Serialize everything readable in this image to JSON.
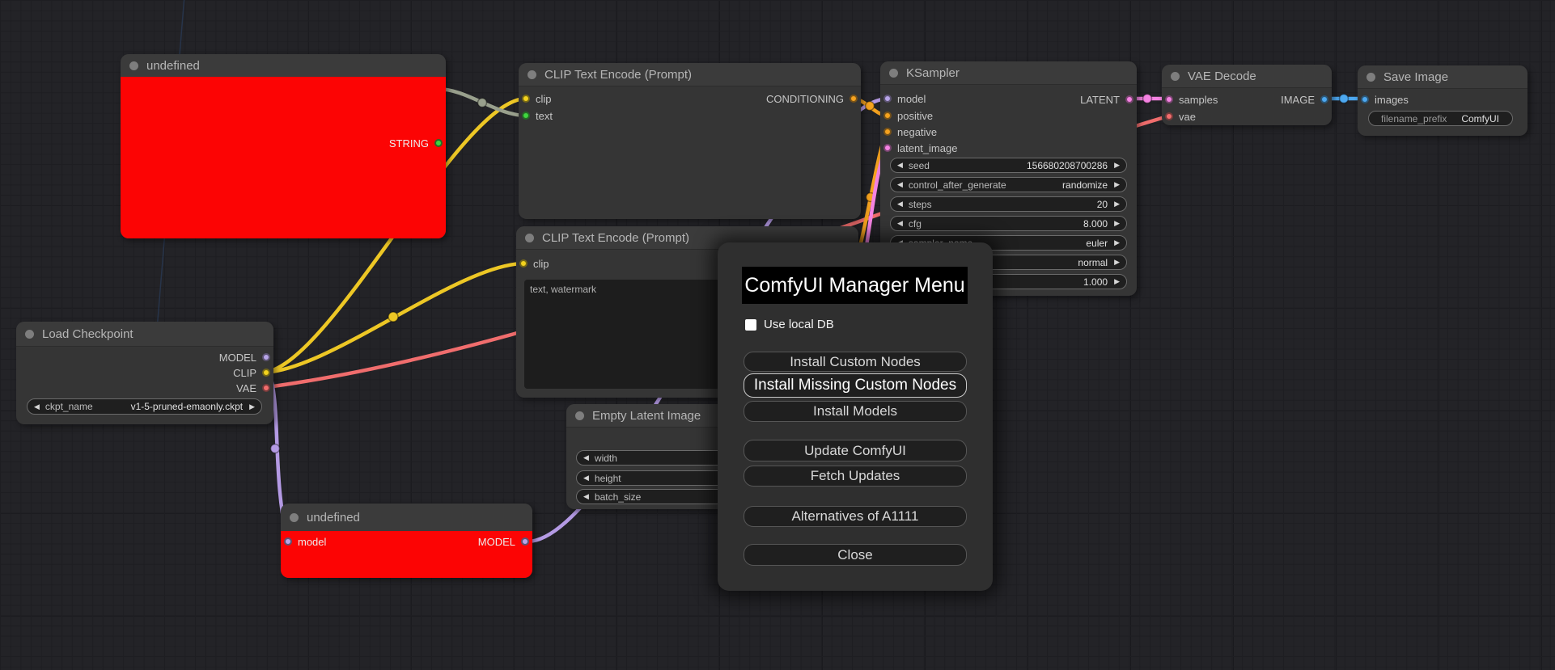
{
  "canvas": {
    "background": "#232327",
    "grid_color": "#1e1e22"
  },
  "colors": {
    "string_slot": "#3fd63f",
    "string_wire": "#99a08d",
    "clip": "#f2d21e",
    "conditioning": "#f5a21f",
    "model": "#b8a5e8",
    "latent": "#f583e3",
    "vae": "#f26d6d",
    "image": "#4da8f0",
    "node_error_body": "#fc0404",
    "dialog_bg": "#2f2f2f",
    "dialog_title_bg": "#000000"
  },
  "nodes": {
    "undefined_top": {
      "title": "undefined",
      "outputs": [
        {
          "label": "STRING"
        }
      ]
    },
    "clip_encode_1": {
      "title": "CLIP Text Encode (Prompt)",
      "inputs": [
        {
          "label": "clip"
        },
        {
          "label": "text"
        }
      ],
      "outputs": [
        {
          "label": "CONDITIONING"
        }
      ]
    },
    "clip_encode_2": {
      "title": "CLIP Text Encode (Prompt)",
      "inputs": [
        {
          "label": "clip"
        }
      ],
      "text_value": "text, watermark"
    },
    "ksampler": {
      "title": "KSampler",
      "inputs": [
        {
          "label": "model"
        },
        {
          "label": "positive"
        },
        {
          "label": "negative"
        },
        {
          "label": "latent_image"
        }
      ],
      "outputs": [
        {
          "label": "LATENT"
        }
      ],
      "widgets": [
        {
          "label": "seed",
          "value": "156680208700286"
        },
        {
          "label": "control_after_generate",
          "value": "randomize"
        },
        {
          "label": "steps",
          "value": "20"
        },
        {
          "label": "cfg",
          "value": "8.000"
        },
        {
          "label": "sampler_name",
          "value": "euler"
        },
        {
          "label": "",
          "value": "normal"
        },
        {
          "label": "",
          "value": "1.000"
        }
      ]
    },
    "vae_decode": {
      "title": "VAE Decode",
      "inputs": [
        {
          "label": "samples"
        },
        {
          "label": "vae"
        }
      ],
      "outputs": [
        {
          "label": "IMAGE"
        }
      ]
    },
    "save_image": {
      "title": "Save Image",
      "inputs": [
        {
          "label": "images"
        }
      ],
      "widgets": [
        {
          "label": "filename_prefix",
          "value": "ComfyUI"
        }
      ]
    },
    "load_checkpoint": {
      "title": "Load Checkpoint",
      "outputs": [
        {
          "label": "MODEL"
        },
        {
          "label": "CLIP"
        },
        {
          "label": "VAE"
        }
      ],
      "widgets": [
        {
          "label": "ckpt_name",
          "value": "v1-5-pruned-emaonly.ckpt"
        }
      ]
    },
    "empty_latent": {
      "title": "Empty Latent Image",
      "widgets": [
        {
          "label": "width",
          "value": ""
        },
        {
          "label": "height",
          "value": ""
        },
        {
          "label": "batch_size",
          "value": ""
        }
      ]
    },
    "undefined_bottom": {
      "title": "undefined",
      "inputs": [
        {
          "label": "model"
        }
      ],
      "outputs": [
        {
          "label": "MODEL"
        }
      ]
    }
  },
  "dialog": {
    "title": "ComfyUI Manager Menu",
    "checkbox": {
      "label": "Use local DB",
      "checked": false
    },
    "buttons": [
      {
        "label": "Install Custom Nodes",
        "highlighted": false
      },
      {
        "label": "Install Missing Custom Nodes",
        "highlighted": true
      },
      {
        "label": "Install Models",
        "highlighted": false
      },
      {
        "label": "Update ComfyUI",
        "highlighted": false
      },
      {
        "label": "Fetch Updates",
        "highlighted": false
      },
      {
        "label": "Alternatives of A1111",
        "highlighted": false
      },
      {
        "label": "Close",
        "highlighted": false
      }
    ]
  }
}
